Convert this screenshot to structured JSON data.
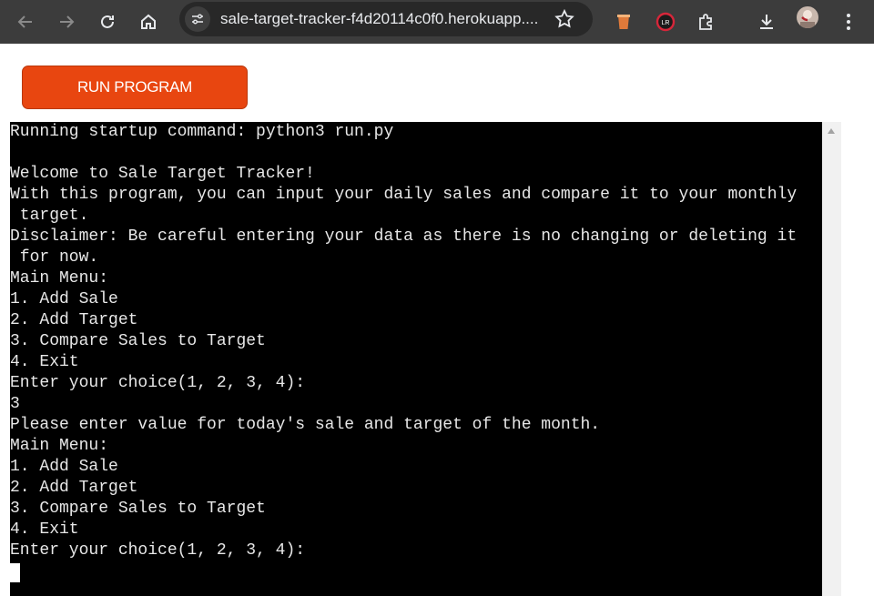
{
  "browser": {
    "url": "sale-target-tracker-f4d20114c0f0.herokuapp....",
    "icons": [
      "back-arrow-icon",
      "forward-arrow-icon",
      "reload-icon",
      "home-icon",
      "site-info-icon",
      "bookmark-star-icon",
      "extension-cup-icon",
      "extension-lr-icon",
      "extensions-puzzle-icon",
      "download-icon",
      "profile-avatar",
      "menu-dots-icon"
    ]
  },
  "page": {
    "run_button_label": "RUN PROGRAM"
  },
  "terminal": {
    "lines": [
      "Running startup command: python3 run.py",
      "",
      "Welcome to Sale Target Tracker!",
      "With this program, you can input your daily sales and compare it to your monthly",
      " target.",
      "Disclaimer: Be careful entering your data as there is no changing or deleting it",
      " for now.",
      "Main Menu:",
      "1. Add Sale",
      "2. Add Target",
      "3. Compare Sales to Target",
      "4. Exit",
      "Enter your choice(1, 2, 3, 4):",
      "3",
      "Please enter value for today's sale and target of the month.",
      "Main Menu:",
      "1. Add Sale",
      "2. Add Target",
      "3. Compare Sales to Target",
      "4. Exit",
      "Enter your choice(1, 2, 3, 4):"
    ]
  }
}
